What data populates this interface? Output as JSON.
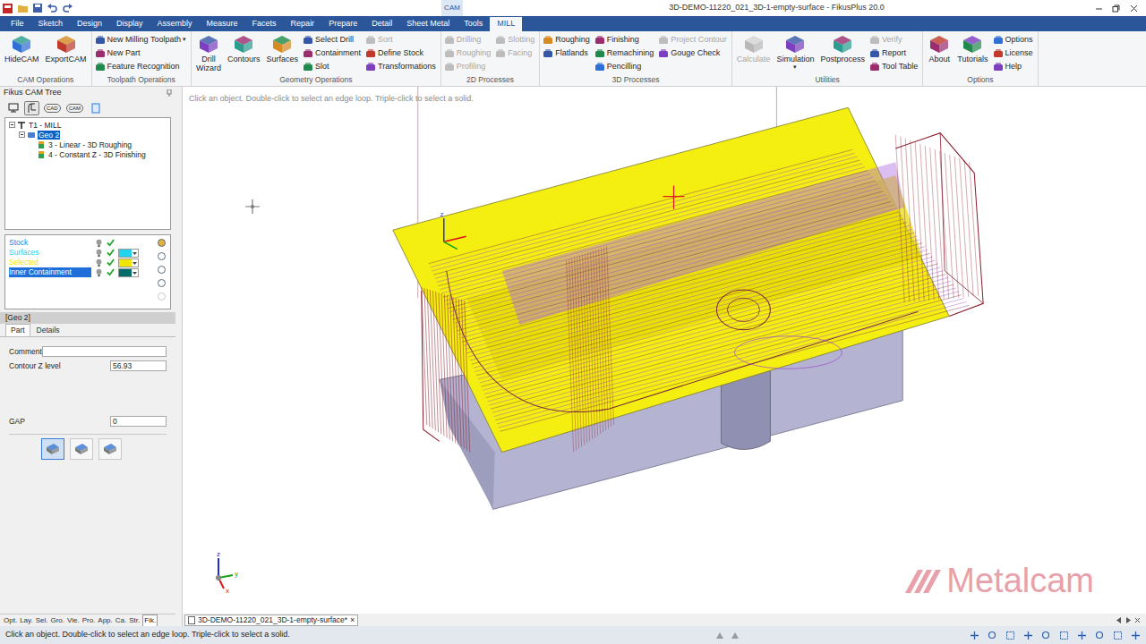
{
  "window": {
    "title": "3D-DEMO-11220_021_3D-1-empty-surface - FikusPlus 20.0",
    "context_tab": "CAM"
  },
  "menu": [
    {
      "label": "File",
      "selected": false
    },
    {
      "label": "Sketch",
      "selected": false
    },
    {
      "label": "Design",
      "selected": false
    },
    {
      "label": "Display",
      "selected": false
    },
    {
      "label": "Assembly",
      "selected": false
    },
    {
      "label": "Measure",
      "selected": false
    },
    {
      "label": "Facets",
      "selected": false
    },
    {
      "label": "Repair",
      "selected": false
    },
    {
      "label": "Prepare",
      "selected": false
    },
    {
      "label": "Detail",
      "selected": false
    },
    {
      "label": "Sheet Metal",
      "selected": false
    },
    {
      "label": "Tools",
      "selected": false
    },
    {
      "label": "MILL",
      "selected": true
    }
  ],
  "ribbon": [
    {
      "label": "CAM Operations",
      "columns": [
        [
          {
            "label": "HideCAM",
            "kind": "large",
            "disabled": false
          }
        ],
        [
          {
            "label": "ExportCAM",
            "kind": "large",
            "disabled": false
          }
        ]
      ]
    },
    {
      "label": "Toolpath Operations",
      "columns": [
        [
          {
            "label": "New Milling Toolpath",
            "arrow": "▾",
            "kind": "small",
            "disabled": false
          },
          {
            "label": "New Part",
            "kind": "small",
            "disabled": false
          },
          {
            "label": "Feature Recognition",
            "kind": "small",
            "disabled": false
          }
        ]
      ]
    },
    {
      "label": "Geometry Operations",
      "columns": [
        [
          {
            "label": "Drill Wizard",
            "kind": "large",
            "disabled": false
          }
        ],
        [
          {
            "label": "Contours",
            "kind": "large",
            "disabled": false
          }
        ],
        [
          {
            "label": "Surfaces",
            "kind": "large",
            "disabled": false
          }
        ],
        [
          {
            "label": "Select Drill",
            "kind": "small",
            "disabled": false
          },
          {
            "label": "Containment",
            "kind": "small",
            "disabled": false
          },
          {
            "label": "Slot",
            "kind": "small",
            "disabled": false
          }
        ],
        [
          {
            "label": "Sort",
            "kind": "small",
            "disabled": true
          },
          {
            "label": "Define Stock",
            "kind": "small",
            "disabled": false
          },
          {
            "label": "Transformations",
            "kind": "small",
            "disabled": false
          }
        ]
      ]
    },
    {
      "label": "2D Processes",
      "columns": [
        [
          {
            "label": "Drilling",
            "kind": "small",
            "disabled": true
          },
          {
            "label": "Roughing",
            "kind": "small",
            "disabled": true
          },
          {
            "label": "Profiling",
            "kind": "small",
            "disabled": true
          }
        ],
        [
          {
            "label": "Slotting",
            "kind": "small",
            "disabled": true
          },
          {
            "label": "Facing",
            "kind": "small",
            "disabled": true
          }
        ]
      ]
    },
    {
      "label": "3D Processes",
      "columns": [
        [
          {
            "label": "Roughing",
            "kind": "small",
            "disabled": false
          },
          {
            "label": "Flatlands",
            "kind": "small",
            "disabled": false
          }
        ],
        [
          {
            "label": "Finishing",
            "kind": "small",
            "disabled": false
          },
          {
            "label": "Remachining",
            "kind": "small",
            "disabled": false
          },
          {
            "label": "Pencilling",
            "kind": "small",
            "disabled": false
          }
        ],
        [
          {
            "label": "Project Contour",
            "kind": "small",
            "disabled": true
          },
          {
            "label": "Gouge Check",
            "kind": "small",
            "disabled": false
          }
        ]
      ]
    },
    {
      "label": "Utilities",
      "columns": [
        [
          {
            "label": "Calculate",
            "kind": "large",
            "disabled": true
          }
        ],
        [
          {
            "label": "Simulation",
            "arrow": "▾",
            "kind": "large",
            "disabled": false
          }
        ],
        [
          {
            "label": "Postprocess",
            "kind": "large",
            "disabled": false
          }
        ],
        [
          {
            "label": "Verify",
            "kind": "small",
            "disabled": true
          },
          {
            "label": "Report",
            "kind": "small",
            "disabled": false
          },
          {
            "label": "Tool Table",
            "kind": "small",
            "disabled": false
          }
        ]
      ]
    },
    {
      "label": "Options",
      "columns": [
        [
          {
            "label": "About",
            "kind": "large",
            "disabled": false
          }
        ],
        [
          {
            "label": "Tutorials",
            "kind": "large",
            "disabled": false
          }
        ],
        [
          {
            "label": "Options",
            "kind": "small",
            "disabled": false
          },
          {
            "label": "License",
            "kind": "small",
            "disabled": false
          },
          {
            "label": "Help",
            "kind": "small",
            "disabled": false
          }
        ]
      ]
    }
  ],
  "tree_panel": {
    "title": "Fikus CAM Tree",
    "toolbar": [
      {
        "kind": "monitor",
        "selected": false
      },
      {
        "kind": "toolpath",
        "selected": true
      },
      {
        "kind": "text",
        "label": "CAD",
        "selected": false
      },
      {
        "kind": "text",
        "label": "CAM",
        "selected": false
      },
      {
        "kind": "page",
        "selected": false
      }
    ],
    "tree": [
      {
        "label": "T1 - MILL",
        "level": 0,
        "expanded": true,
        "selected": false
      },
      {
        "label": "Geo 2",
        "level": 1,
        "expanded": true,
        "selected": true
      },
      {
        "label": "3 - Linear - 3D Roughing",
        "level": 2,
        "expanded": false,
        "selected": false
      },
      {
        "label": "4 - Constant Z - 3D Finishing",
        "level": 2,
        "expanded": false,
        "selected": false
      }
    ]
  },
  "layers": [
    {
      "name": "Stock",
      "selected": false,
      "visible": true,
      "checked": true,
      "swatch": false,
      "color": "#1e7fe0"
    },
    {
      "name": "Surfaces",
      "selected": false,
      "visible": true,
      "checked": true,
      "swatch": true,
      "color": "#22d3ee"
    },
    {
      "name": "Selected",
      "selected": false,
      "visible": true,
      "checked": true,
      "swatch": true,
      "color": "#f2e600"
    },
    {
      "name": "Inner Containment",
      "selected": true,
      "visible": true,
      "checked": true,
      "swatch": true,
      "color": "#006c6c"
    }
  ],
  "part_panel": {
    "title": "[Geo 2]",
    "tabs": [
      {
        "label": "Part",
        "selected": true
      },
      {
        "label": "Details",
        "selected": false
      }
    ],
    "fields": [
      {
        "label": "Comment",
        "value": ""
      },
      {
        "label": "Contour Z level",
        "value": "56.93"
      },
      {
        "label": "GAP",
        "value": "0"
      }
    ],
    "buttons": [
      {
        "selected": true
      },
      {
        "selected": false
      },
      {
        "selected": false
      }
    ]
  },
  "bottom_tabs": [
    {
      "label": "Opt.",
      "selected": false
    },
    {
      "label": "Lay.",
      "selected": false
    },
    {
      "label": "Sel.",
      "selected": false
    },
    {
      "label": "Gro.",
      "selected": false
    },
    {
      "label": "Vie.",
      "selected": false
    },
    {
      "label": "Pro.",
      "selected": false
    },
    {
      "label": "App.",
      "selected": false
    },
    {
      "label": "Ca.",
      "selected": false
    },
    {
      "label": "Str.",
      "selected": false
    },
    {
      "label": "Fik.",
      "selected": true
    }
  ],
  "viewport": {
    "hint": "Click an object. Double-click to select an edge loop. Triple-click to select a solid.",
    "origin_label": "z",
    "axes": [
      {
        "label": "z",
        "color": "#1d2bd8"
      },
      {
        "label": "y",
        "color": "#13a313"
      },
      {
        "label": "x",
        "color": "#e01616"
      }
    ],
    "watermark": "Metalcam"
  },
  "doc_tab": {
    "label": "3D-DEMO-11220_021_3D-1-empty-surface*",
    "close": "×",
    "selected": true
  },
  "status_bar": {
    "text": "Click an object. Double-click to select an edge loop. Triple-click to select a solid."
  }
}
